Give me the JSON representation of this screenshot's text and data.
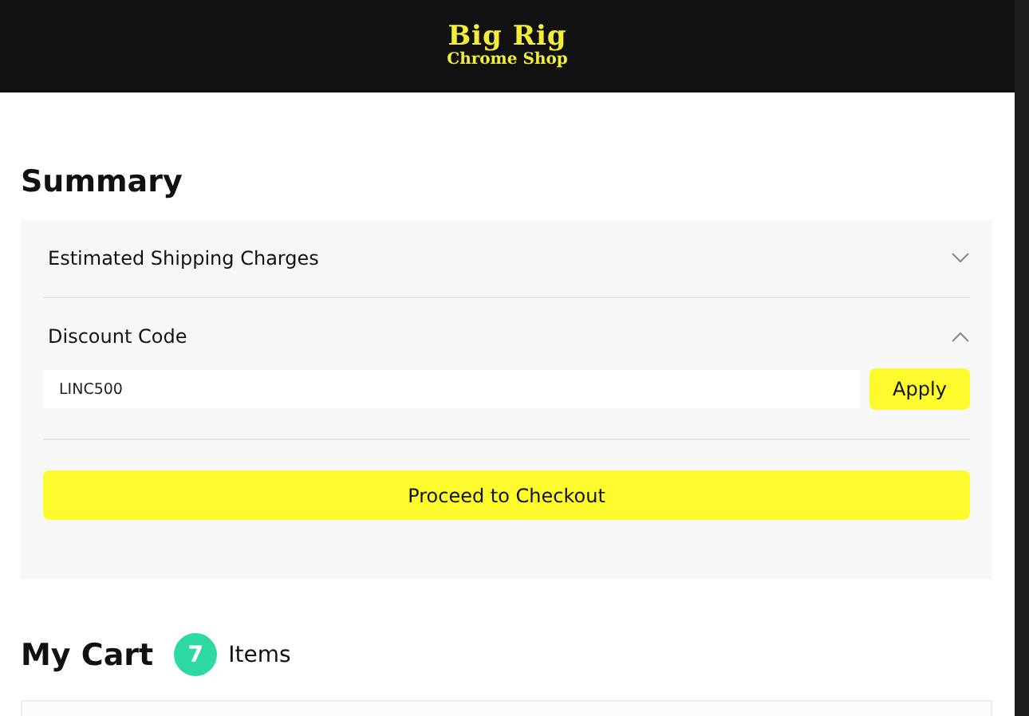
{
  "header": {
    "logo": {
      "line_1": "Big Rig",
      "line_2": "Chrome Shop"
    }
  },
  "summary": {
    "title": "Summary",
    "sections": [
      {
        "title": "Estimated Shipping Charges",
        "expanded": false
      },
      {
        "title": "Discount Code",
        "expanded": true,
        "value": "LINC500",
        "button": "Apply"
      }
    ],
    "checkout_button": "Proceed to Checkout"
  },
  "cart": {
    "title": "My Cart",
    "count": "7",
    "count_label": "Items"
  }
}
